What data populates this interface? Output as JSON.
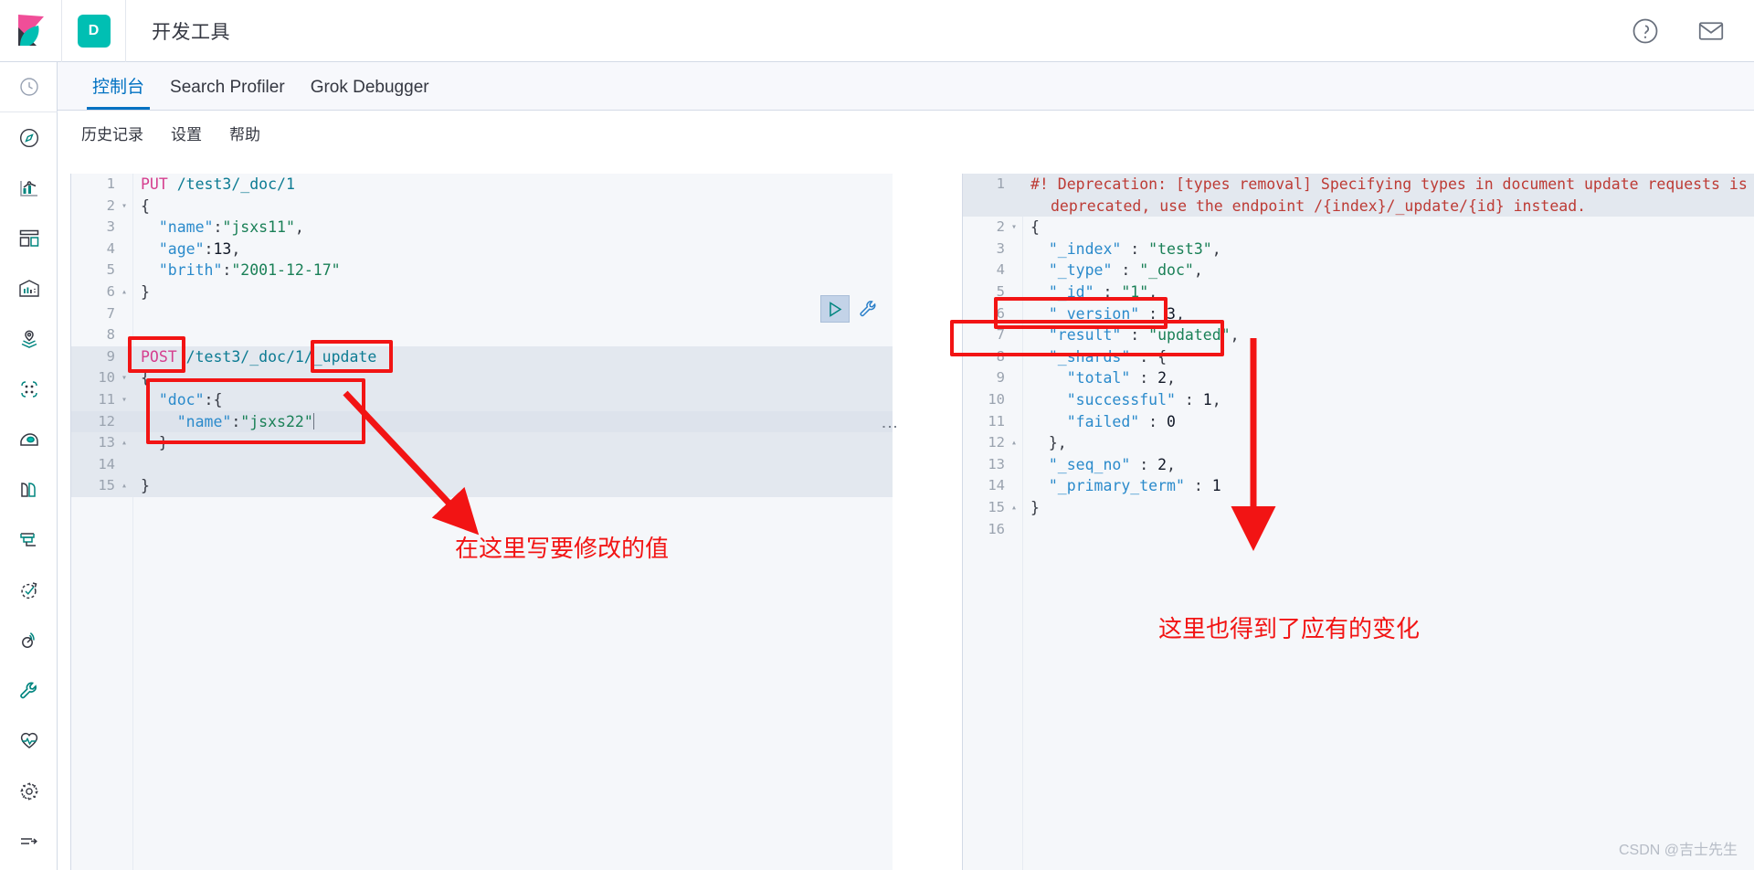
{
  "header": {
    "app_title": "开发工具",
    "space_badge": "D",
    "logo_icon": "kibana-logo",
    "help_icon": "help-circle-icon",
    "mail_icon": "mail-icon"
  },
  "rail": {
    "items": [
      {
        "icon": "recently-viewed-clock-icon"
      },
      {
        "icon": "discover-compass-icon"
      },
      {
        "icon": "visualize-chart-icon"
      },
      {
        "icon": "dashboard-grid-icon"
      },
      {
        "icon": "canvas-frame-icon"
      },
      {
        "icon": "maps-pin-icon"
      },
      {
        "icon": "machine-learning-nodes-icon"
      },
      {
        "icon": "infrastructure-icon"
      },
      {
        "icon": "logs-pages-icon"
      },
      {
        "icon": "apm-funnel-icon"
      },
      {
        "icon": "uptime-check-icon"
      },
      {
        "icon": "siem-radar-icon"
      },
      {
        "icon": "dev-tools-wrench-icon"
      },
      {
        "icon": "monitoring-heartbeat-icon"
      },
      {
        "icon": "management-gear-icon"
      },
      {
        "icon": "collapse-arrow-icon"
      }
    ]
  },
  "tabs": [
    {
      "label": "控制台",
      "active": true
    },
    {
      "label": "Search Profiler",
      "active": false
    },
    {
      "label": "Grok Debugger",
      "active": false
    }
  ],
  "subnav": [
    {
      "label": "历史记录"
    },
    {
      "label": "设置"
    },
    {
      "label": "帮助"
    }
  ],
  "request_editor": {
    "lines": [
      {
        "n": "1",
        "fold": "",
        "segments": [
          {
            "t": "PUT ",
            "c": "m-put"
          },
          {
            "t": "/test3/_doc/1",
            "c": "url"
          }
        ]
      },
      {
        "n": "2",
        "fold": "▾",
        "segments": [
          {
            "t": "{",
            "c": "punc"
          }
        ]
      },
      {
        "n": "3",
        "fold": "",
        "segments": [
          {
            "t": "  ",
            "c": "punc"
          },
          {
            "t": "\"name\"",
            "c": "key"
          },
          {
            "t": ":",
            "c": "punc"
          },
          {
            "t": "\"jsxs11\"",
            "c": "str"
          },
          {
            "t": ",",
            "c": "punc"
          }
        ]
      },
      {
        "n": "4",
        "fold": "",
        "segments": [
          {
            "t": "  ",
            "c": "punc"
          },
          {
            "t": "\"age\"",
            "c": "key"
          },
          {
            "t": ":",
            "c": "punc"
          },
          {
            "t": "13",
            "c": "num"
          },
          {
            "t": ",",
            "c": "punc"
          }
        ]
      },
      {
        "n": "5",
        "fold": "",
        "segments": [
          {
            "t": "  ",
            "c": "punc"
          },
          {
            "t": "\"brith\"",
            "c": "key"
          },
          {
            "t": ":",
            "c": "punc"
          },
          {
            "t": "\"2001-12-17\"",
            "c": "str"
          }
        ]
      },
      {
        "n": "6",
        "fold": "▴",
        "segments": [
          {
            "t": "}",
            "c": "punc"
          }
        ]
      },
      {
        "n": "7",
        "fold": "",
        "segments": []
      },
      {
        "n": "8",
        "fold": "",
        "segments": []
      },
      {
        "n": "9",
        "fold": "",
        "segments": [
          {
            "t": "POST ",
            "c": "m-post"
          },
          {
            "t": "/test3/_doc/1/_update",
            "c": "url"
          }
        ]
      },
      {
        "n": "10",
        "fold": "▾",
        "segments": [
          {
            "t": "{",
            "c": "punc"
          }
        ]
      },
      {
        "n": "11",
        "fold": "▾",
        "segments": [
          {
            "t": "  ",
            "c": "punc"
          },
          {
            "t": "\"doc\"",
            "c": "key"
          },
          {
            "t": ":",
            "c": "punc"
          },
          {
            "t": "{",
            "c": "punc"
          }
        ]
      },
      {
        "n": "12",
        "fold": "",
        "segments": [
          {
            "t": "    ",
            "c": "punc"
          },
          {
            "t": "\"name\"",
            "c": "key"
          },
          {
            "t": ":",
            "c": "punc"
          },
          {
            "t": "\"jsxs22\"",
            "c": "str"
          }
        ]
      },
      {
        "n": "13",
        "fold": "▴",
        "segments": [
          {
            "t": "  ",
            "c": "punc"
          },
          {
            "t": "}",
            "c": "punc"
          }
        ]
      },
      {
        "n": "14",
        "fold": "",
        "segments": []
      },
      {
        "n": "15",
        "fold": "▴",
        "segments": [
          {
            "t": "}",
            "c": "punc"
          }
        ]
      }
    ],
    "play_button_label": "▷",
    "wrench_label": "wrench"
  },
  "response_editor": {
    "deprecation_line_1": "#! Deprecation: [types removal] Specifying types in document update requests is",
    "deprecation_line_2": "deprecated, use the endpoint /{index}/_update/{id} instead.",
    "lines": [
      {
        "n": "2",
        "fold": "▾",
        "segments": [
          {
            "t": "{",
            "c": "punc"
          }
        ]
      },
      {
        "n": "3",
        "fold": "",
        "segments": [
          {
            "t": "  ",
            "c": "punc"
          },
          {
            "t": "\"_index\"",
            "c": "key"
          },
          {
            "t": " : ",
            "c": "punc"
          },
          {
            "t": "\"test3\"",
            "c": "str"
          },
          {
            "t": ",",
            "c": "punc"
          }
        ]
      },
      {
        "n": "4",
        "fold": "",
        "segments": [
          {
            "t": "  ",
            "c": "punc"
          },
          {
            "t": "\"_type\"",
            "c": "key"
          },
          {
            "t": " : ",
            "c": "punc"
          },
          {
            "t": "\"_doc\"",
            "c": "str"
          },
          {
            "t": ",",
            "c": "punc"
          }
        ]
      },
      {
        "n": "5",
        "fold": "",
        "segments": [
          {
            "t": "  ",
            "c": "punc"
          },
          {
            "t": "\"_id\"",
            "c": "key"
          },
          {
            "t": " : ",
            "c": "punc"
          },
          {
            "t": "\"1\"",
            "c": "str"
          },
          {
            "t": ",",
            "c": "punc"
          }
        ]
      },
      {
        "n": "6",
        "fold": "",
        "segments": [
          {
            "t": "  ",
            "c": "punc"
          },
          {
            "t": "\"_version\"",
            "c": "key"
          },
          {
            "t": " : ",
            "c": "punc"
          },
          {
            "t": "3",
            "c": "num"
          },
          {
            "t": ",",
            "c": "punc"
          }
        ]
      },
      {
        "n": "7",
        "fold": "",
        "segments": [
          {
            "t": "  ",
            "c": "punc"
          },
          {
            "t": "\"result\"",
            "c": "key"
          },
          {
            "t": " : ",
            "c": "punc"
          },
          {
            "t": "\"updated\"",
            "c": "str"
          },
          {
            "t": ",",
            "c": "punc"
          }
        ]
      },
      {
        "n": "8",
        "fold": "",
        "segments": [
          {
            "t": "  ",
            "c": "punc"
          },
          {
            "t": "\"_shards\"",
            "c": "key"
          },
          {
            "t": " : ",
            "c": "punc"
          },
          {
            "t": "{",
            "c": "punc"
          }
        ]
      },
      {
        "n": "9",
        "fold": "",
        "segments": [
          {
            "t": "    ",
            "c": "punc"
          },
          {
            "t": "\"total\"",
            "c": "key"
          },
          {
            "t": " : ",
            "c": "punc"
          },
          {
            "t": "2",
            "c": "num"
          },
          {
            "t": ",",
            "c": "punc"
          }
        ]
      },
      {
        "n": "10",
        "fold": "",
        "segments": [
          {
            "t": "    ",
            "c": "punc"
          },
          {
            "t": "\"successful\"",
            "c": "key"
          },
          {
            "t": " : ",
            "c": "punc"
          },
          {
            "t": "1",
            "c": "num"
          },
          {
            "t": ",",
            "c": "punc"
          }
        ]
      },
      {
        "n": "11",
        "fold": "",
        "segments": [
          {
            "t": "    ",
            "c": "punc"
          },
          {
            "t": "\"failed\"",
            "c": "key"
          },
          {
            "t": " : ",
            "c": "punc"
          },
          {
            "t": "0",
            "c": "num"
          }
        ]
      },
      {
        "n": "12",
        "fold": "▴",
        "segments": [
          {
            "t": "  ",
            "c": "punc"
          },
          {
            "t": "},",
            "c": "punc"
          }
        ]
      },
      {
        "n": "13",
        "fold": "",
        "segments": [
          {
            "t": "  ",
            "c": "punc"
          },
          {
            "t": "\"_seq_no\"",
            "c": "key"
          },
          {
            "t": " : ",
            "c": "punc"
          },
          {
            "t": "2",
            "c": "num"
          },
          {
            "t": ",",
            "c": "punc"
          }
        ]
      },
      {
        "n": "14",
        "fold": "",
        "segments": [
          {
            "t": "  ",
            "c": "punc"
          },
          {
            "t": "\"_primary_term\"",
            "c": "key"
          },
          {
            "t": " : ",
            "c": "punc"
          },
          {
            "t": "1",
            "c": "num"
          }
        ]
      },
      {
        "n": "15",
        "fold": "▴",
        "segments": [
          {
            "t": "}",
            "c": "punc"
          }
        ]
      },
      {
        "n": "16",
        "fold": "",
        "segments": []
      }
    ]
  },
  "annotations": {
    "left_note": "在这里写要修改的值",
    "right_note": "这里也得到了应有的变化",
    "accent_color": "#f21414"
  },
  "watermark": "CSDN @吉士先生"
}
